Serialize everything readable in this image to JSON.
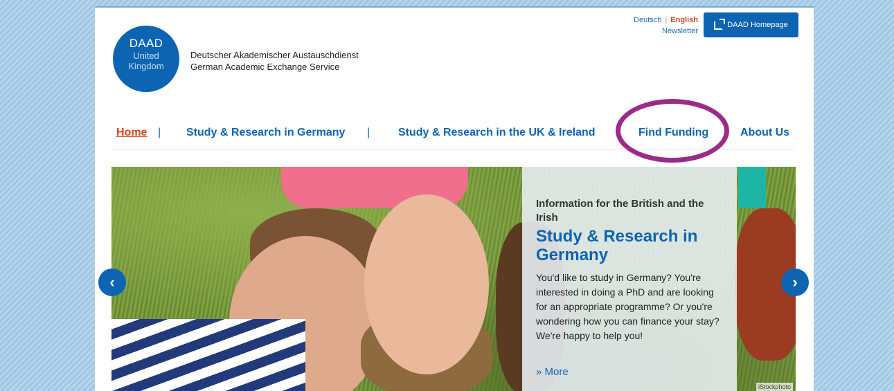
{
  "header": {
    "logo": {
      "line1": "DAAD",
      "line2": "United",
      "line3": "Kingdom"
    },
    "org_name_de": "Deutscher Akademischer Austauschdienst",
    "org_name_en": "German Academic Exchange Service",
    "languages": [
      "Deutsch",
      "English"
    ],
    "active_language": "English",
    "newsletter": "Newsletter",
    "homepage_button": "DAAD Homepage"
  },
  "nav": {
    "items": [
      "Home",
      "Study & Research in Germany",
      "Study & Research in the UK & Ireland",
      "Find Funding",
      "About Us"
    ],
    "separator": "|",
    "active": "Home",
    "highlighted": "Find Funding"
  },
  "hero": {
    "kicker": "Information for the British and the Irish",
    "title": "Study & Research in Germany",
    "body": "You'd like to study in Germany? You're interested in doing a PhD and are looking for an appropriate programme? Or you're wondering how you can finance your stay? We're happy to help you!",
    "more": "» More",
    "image_credit": "iStockphoto",
    "prev_arrow": "‹",
    "next_arrow": "›"
  },
  "colors": {
    "brand_blue": "#0c64b3",
    "active_orange": "#d4451e",
    "highlight_purple": "#9c2a8a"
  }
}
